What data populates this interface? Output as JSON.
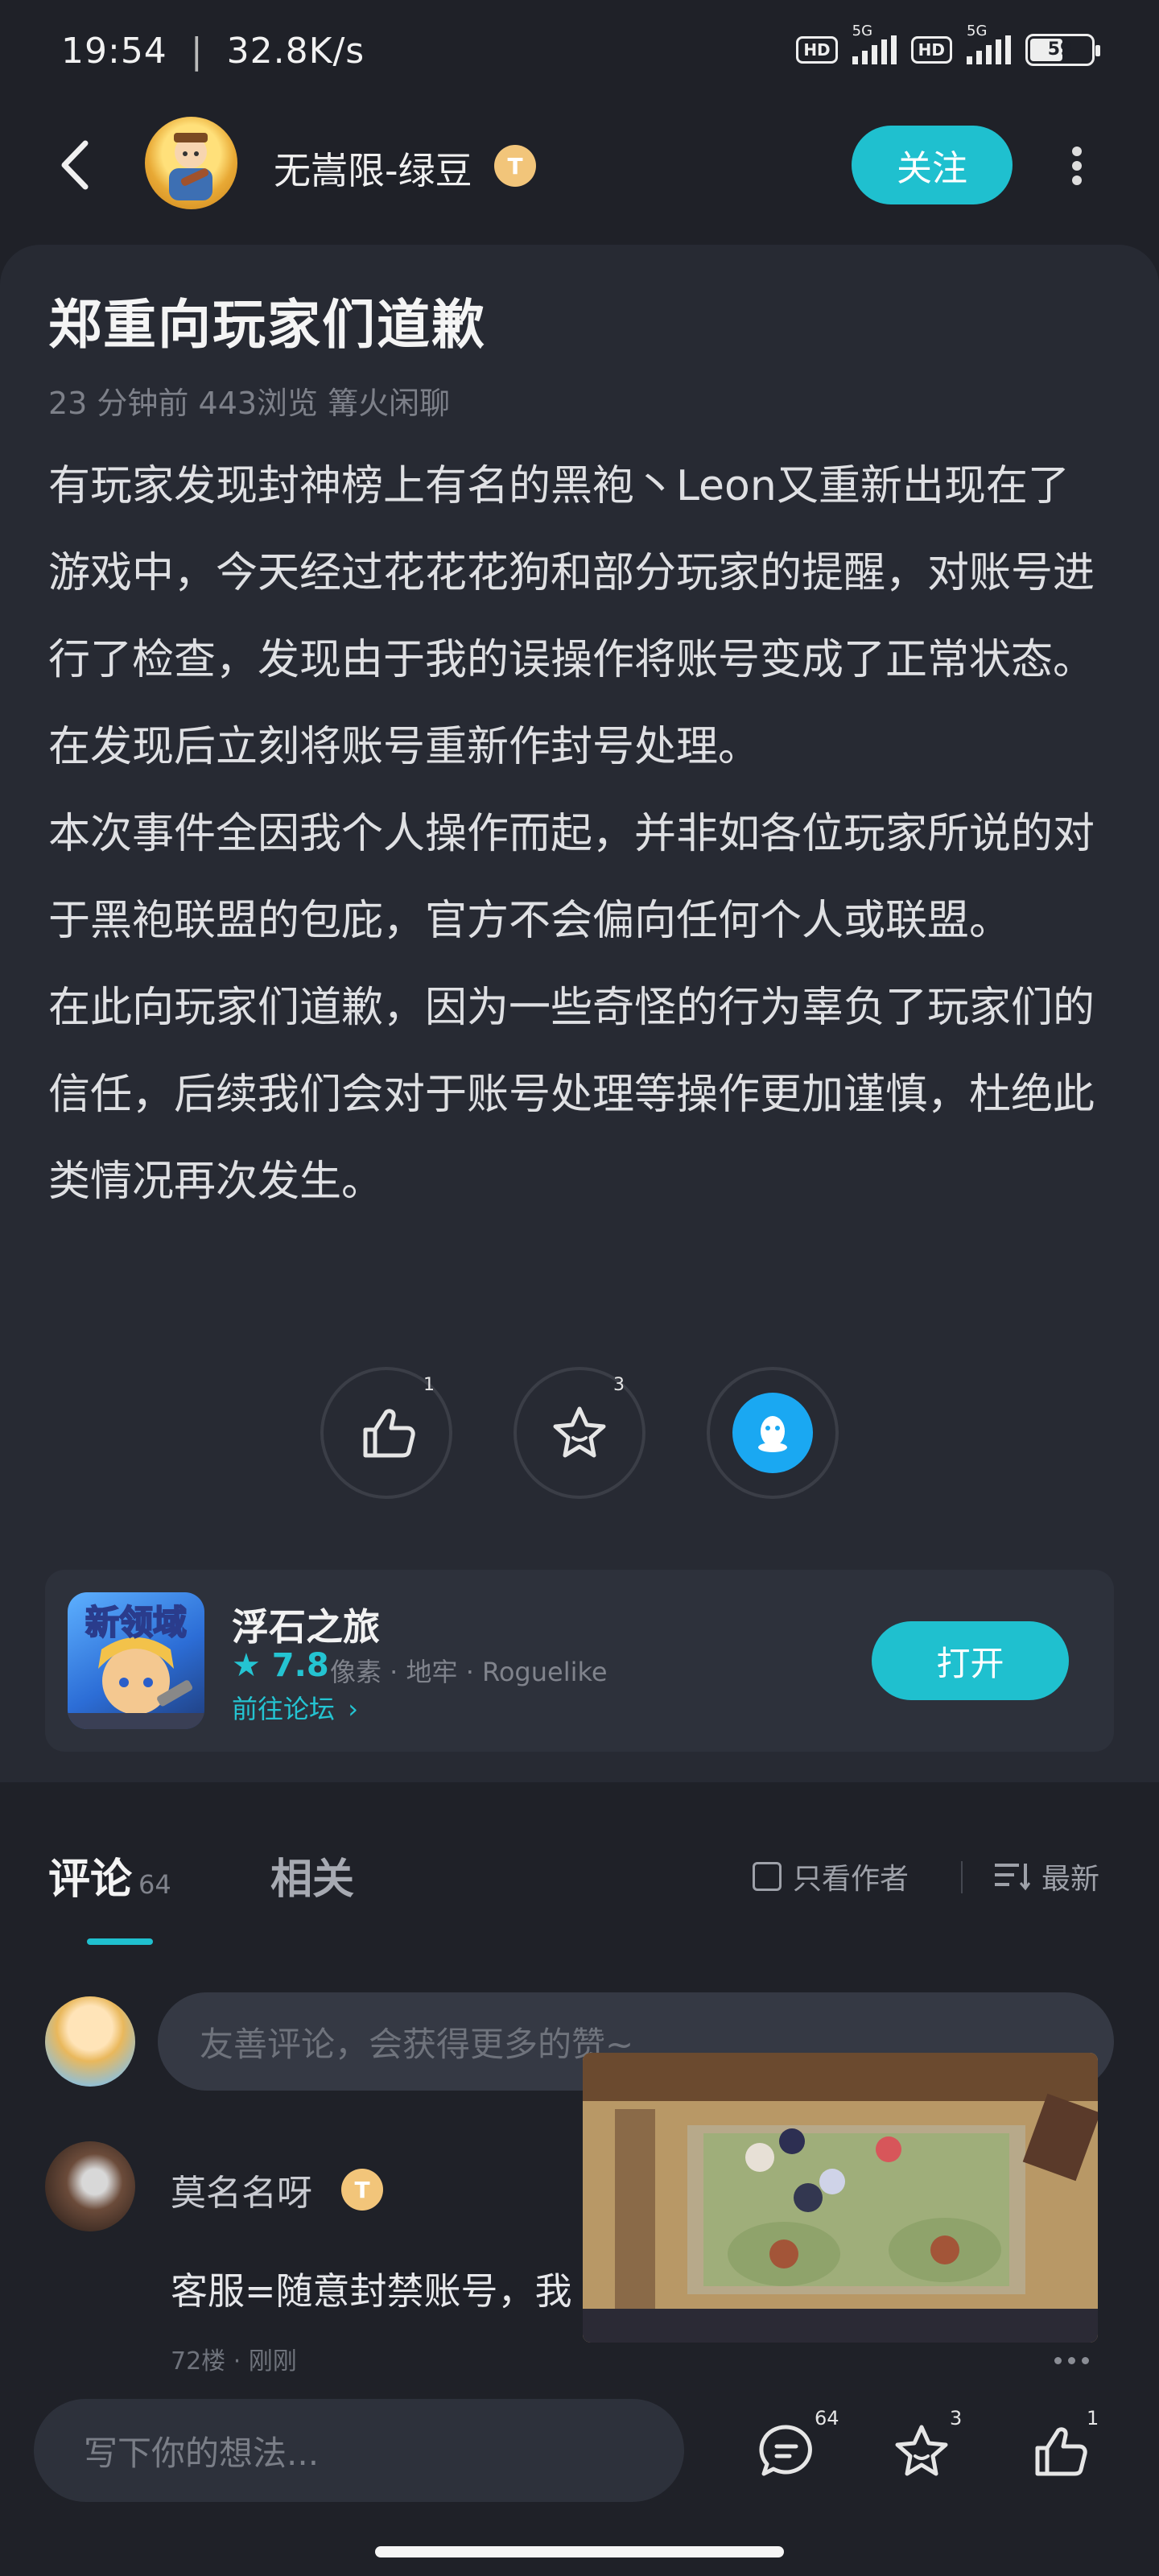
{
  "status_bar": {
    "time": "19:54",
    "speed": "32.8K/s",
    "hd1": "HD",
    "net1": "5G",
    "hd2": "HD",
    "net2": "5G",
    "battery": "59"
  },
  "header": {
    "author_name": "无嵩限-绿豆",
    "badge": "T",
    "follow_label": "关注"
  },
  "article": {
    "title": "郑重向玩家们道歉",
    "meta": "23 分钟前  443浏览  篝火闲聊",
    "paragraphs": [
      "有玩家发现封神榜上有名的黑袍丶Leon又重新出现在了游戏中，今天经过花花花狗和部分玩家的提醒，对账号进行了检查，发现由于我的误操作将账号变成了正常状态。在发现后立刻将账号重新作封号处理。",
      "本次事件全因我个人操作而起，并非如各位玩家所说的对于黑袍联盟的包庇，官方不会偏向任何个人或联盟。",
      "在此向玩家们道歉，因为一些奇怪的行为辜负了玩家们的信任，后续我们会对于账号处理等操作更加谨慎，杜绝此类情况再次发生。"
    ],
    "reactions": {
      "like_count": "1",
      "star_count": "3"
    }
  },
  "game": {
    "icon_text": "新领域",
    "name": "浮石之旅",
    "score": "7.8",
    "tags": "像素 · 地牢 · Roguelike",
    "forum_link": "前往论坛",
    "open_label": "打开"
  },
  "comments": {
    "tab_comment": "评论",
    "comment_count": "64",
    "tab_related": "相关",
    "only_author": "只看作者",
    "sort": "最新",
    "input_placeholder": "友善评论，会获得更多的赞~",
    "items": [
      {
        "name": "莫名名呀",
        "badge": "T",
        "text": "客服=随意封禁账号，我",
        "meta": "72楼 · 刚刚"
      }
    ]
  },
  "bottom_bar": {
    "input_placeholder": "写下你的想法...",
    "comment_count": "64",
    "star_count": "3",
    "like_count": "1"
  },
  "colors": {
    "accent": "#1fc0cf",
    "background": "#1f2128",
    "card": "#272a33"
  }
}
